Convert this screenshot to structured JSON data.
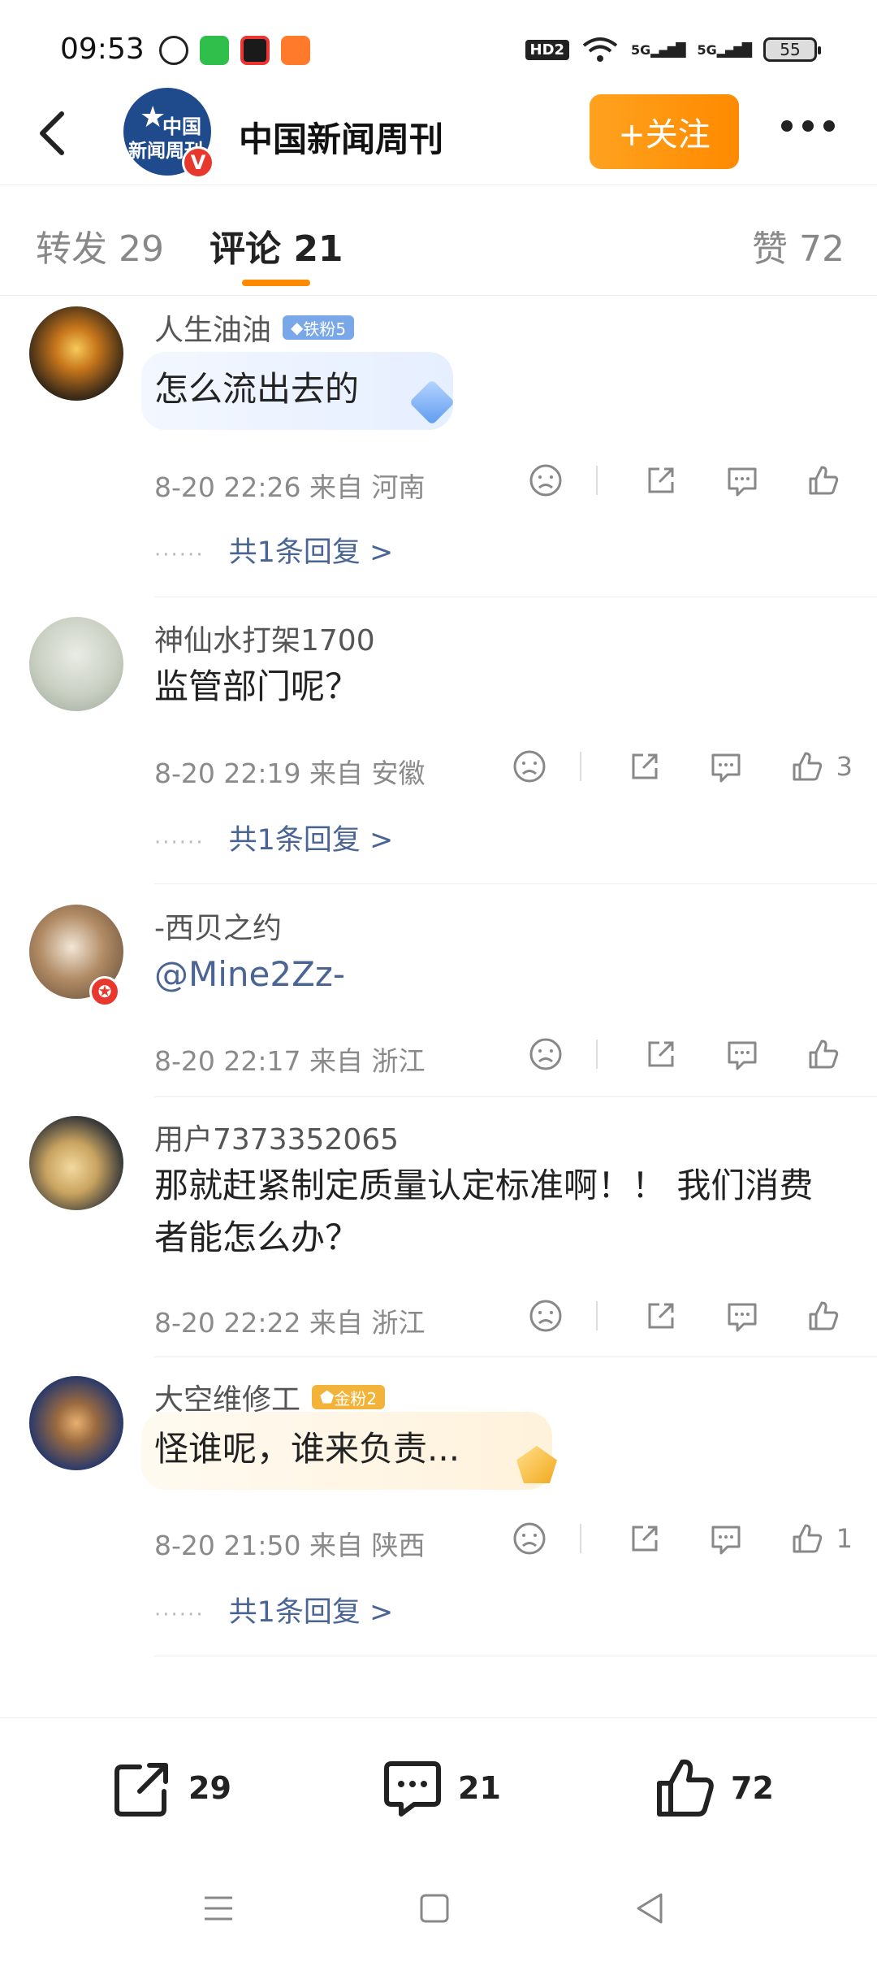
{
  "status": {
    "time": "09:53",
    "hd": "HD2",
    "net1": "5G",
    "net2": "5G",
    "battery": "55"
  },
  "header": {
    "account_name": "中国新闻周刊",
    "avatar_text_1": "中国",
    "avatar_text_2": "新闻周刊",
    "verified": "V",
    "follow_label": "+关注"
  },
  "tabs": [
    {
      "label": "转发 29"
    },
    {
      "label": "评论 21"
    },
    {
      "label": "赞 72"
    }
  ],
  "comments": [
    {
      "name": "人生油油",
      "badge": "铁粉5",
      "text": "怎么流出去的",
      "meta": "8-20 22:26 来自 河南",
      "likes": "",
      "reply": "共1条回复 >"
    },
    {
      "name": "神仙水打架1700",
      "badge": "",
      "text": "监管部门呢？",
      "meta": "8-20 22:19 来自 安徽",
      "likes": "3",
      "reply": "共1条回复 >"
    },
    {
      "name": "-西贝之约",
      "badge": "",
      "text": "@Mine2Zz-",
      "meta": "8-20 22:17 来自 浙江",
      "likes": "",
      "reply": ""
    },
    {
      "name": "用户7373352065",
      "badge": "",
      "text": "那就赶紧制定质量认定标准啊！！ 我们消费者能怎么办？",
      "meta": "8-20 22:22 来自 浙江",
      "likes": "",
      "reply": ""
    },
    {
      "name": "大空维修工",
      "badge": "金粉2",
      "text": "怪谁呢，谁来负责...",
      "meta": "8-20 21:50 来自 陕西",
      "likes": "1",
      "reply": "共1条回复 >"
    }
  ],
  "reply_dots": "······",
  "bottom_bar": {
    "repost_count": "29",
    "comment_count": "21",
    "like_count": "72"
  },
  "colors": {
    "accent": "#ff8a00",
    "link": "#4a6594"
  },
  "icons": [
    "back-arrow-icon",
    "more-icon",
    "dislike-icon",
    "share-icon",
    "comment-icon",
    "like-icon",
    "menu-icon",
    "home-icon",
    "back-nav-icon"
  ]
}
